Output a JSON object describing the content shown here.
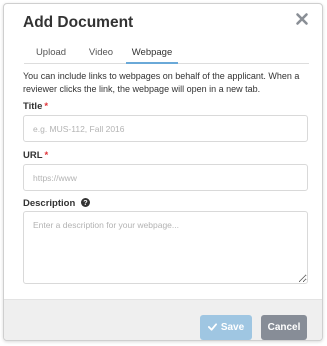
{
  "dialog": {
    "title": "Add Document"
  },
  "tabs": [
    {
      "label": "Upload"
    },
    {
      "label": "Video"
    },
    {
      "label": "Webpage"
    }
  ],
  "active_tab": "Webpage",
  "intro_text": "You can include links to webpages on behalf of the applicant. When a reviewer clicks the link, the webpage will open in a new tab.",
  "fields": {
    "title": {
      "label": "Title",
      "required_mark": "*",
      "placeholder": "e.g. MUS-112, Fall 2016",
      "value": ""
    },
    "url": {
      "label": "URL",
      "required_mark": "*",
      "placeholder": "https://www",
      "value": ""
    },
    "description": {
      "label": "Description",
      "placeholder": "Enter a description for your webpage...",
      "value": ""
    }
  },
  "buttons": {
    "save": "Save",
    "cancel": "Cancel"
  },
  "icons": {
    "close": "close-icon",
    "help": "question-circle-icon",
    "save": "check-icon"
  },
  "colors": {
    "accent": "#6aa9d8",
    "required": "#e0353a",
    "save_button": "#9fc6e2",
    "cancel_button": "#878d97"
  }
}
